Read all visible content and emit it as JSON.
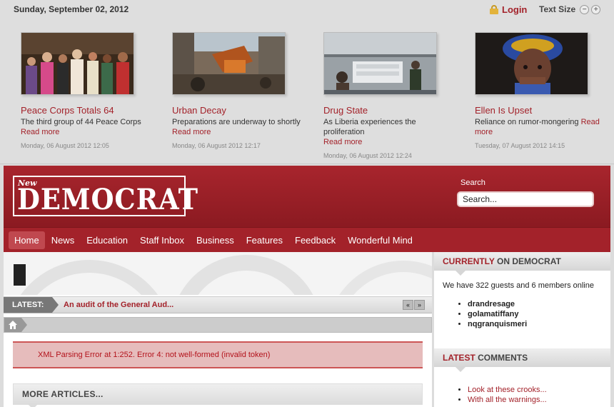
{
  "topbar": {
    "date": "Sunday, September 02, 2012",
    "login_label": "Login",
    "text_size_label": "Text Size",
    "text_size_decrease_icon": "minus-circle-icon",
    "text_size_increase_icon": "plus-circle-icon"
  },
  "features": [
    {
      "title": "Peace Corps Totals 64",
      "desc": "The third group of 44 Peace Corps",
      "read_more": "Read more",
      "date": "Monday, 06 August 2012 12:05"
    },
    {
      "title": "Urban Decay",
      "desc": "Preparations are underway to shortly",
      "read_more": "Read more",
      "date": "Monday, 06 August 2012 12:17"
    },
    {
      "title": "Drug State",
      "desc": "As Liberia experiences the proliferation",
      "read_more": "Read more",
      "date": "Monday, 06 August 2012 12:24"
    },
    {
      "title": "Ellen Is Upset",
      "desc": "Reliance on rumor-mongering",
      "read_more_inline": "Read",
      "read_more": "more",
      "date": "Tuesday, 07 August 2012 14:15"
    }
  ],
  "header": {
    "logo_small": "New",
    "logo_main": "DEMOCRAT",
    "search_label": "Search",
    "search_placeholder": "Search..."
  },
  "nav": {
    "items": [
      "Home",
      "News",
      "Education",
      "Staff Inbox",
      "Business",
      "Features",
      "Feedback",
      "Wonderful Mind"
    ],
    "active": "Home"
  },
  "main": {
    "latest_label": "LATEST:",
    "latest_text": "An audit of the General Aud...",
    "prev_label": "«",
    "next_label": "»",
    "error_text": "XML Parsing Error at 1:252. Error 4: not well-formed (invalid token)",
    "more_articles": "MORE ARTICLES..."
  },
  "sidebar": {
    "online_accent": "CURRENTLY",
    "online_title": "ON DEMOCRAT",
    "online_text": "We have 322 guests and 6 members online",
    "members": [
      "drandresage",
      "golamatiffany",
      "nqgranquismeri"
    ],
    "comments_accent": "LATEST",
    "comments_title": "COMMENTS",
    "comments": [
      "Look at these crooks...",
      "With all the warnings..."
    ]
  },
  "colors": {
    "brand_red": "#a3222a",
    "header_dark_red": "#8b1a21"
  }
}
